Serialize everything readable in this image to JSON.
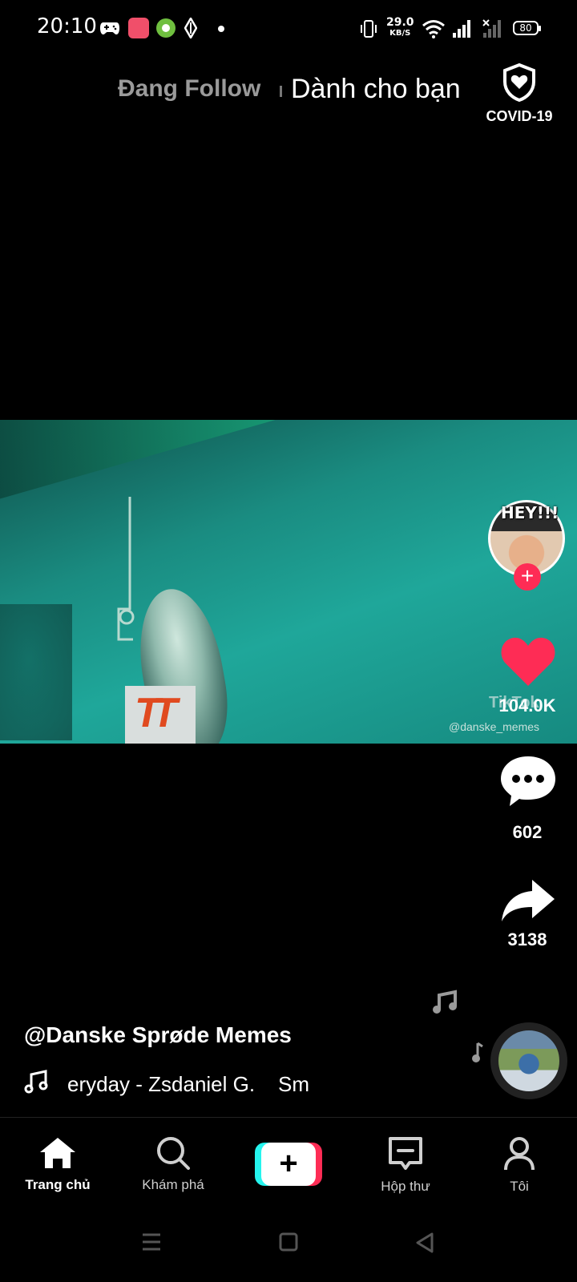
{
  "status_bar": {
    "time": "20:10",
    "net_speed_value": "29.0",
    "net_speed_unit": "KB/S",
    "battery": "80",
    "icons": [
      "gamepad-icon",
      "app-red-icon",
      "app-green-icon",
      "diamond-icon",
      "dot-icon",
      "vibrate-icon",
      "wifi-icon",
      "signal-icon",
      "signal-no-sim-icon",
      "battery-icon"
    ]
  },
  "top_tabs": {
    "following": "Đang Follow",
    "for_you": "Dành cho bạn",
    "covid_label": "COVID-19"
  },
  "video": {
    "avatar_caption": "HEY!!!",
    "watermark_handle": "@danske_memes",
    "watermark_brand": "TikTok"
  },
  "actions": {
    "likes": "104.0K",
    "comments": "602",
    "shares": "3138"
  },
  "caption": {
    "author": "@Danske Sprøde Memes",
    "music": "eryday - Zsdaniel G.    Sm"
  },
  "bottom_nav": {
    "items": [
      {
        "label": "Trang chủ",
        "icon": "home-icon",
        "active": true
      },
      {
        "label": "Khám phá",
        "icon": "search-icon"
      },
      {
        "label": "",
        "icon": "plus-icon"
      },
      {
        "label": "Hộp thư",
        "icon": "inbox-icon"
      },
      {
        "label": "Tôi",
        "icon": "profile-icon"
      }
    ]
  },
  "colors": {
    "accent_red": "#fe2c55",
    "accent_cyan": "#25f4ee",
    "background": "#000000"
  }
}
